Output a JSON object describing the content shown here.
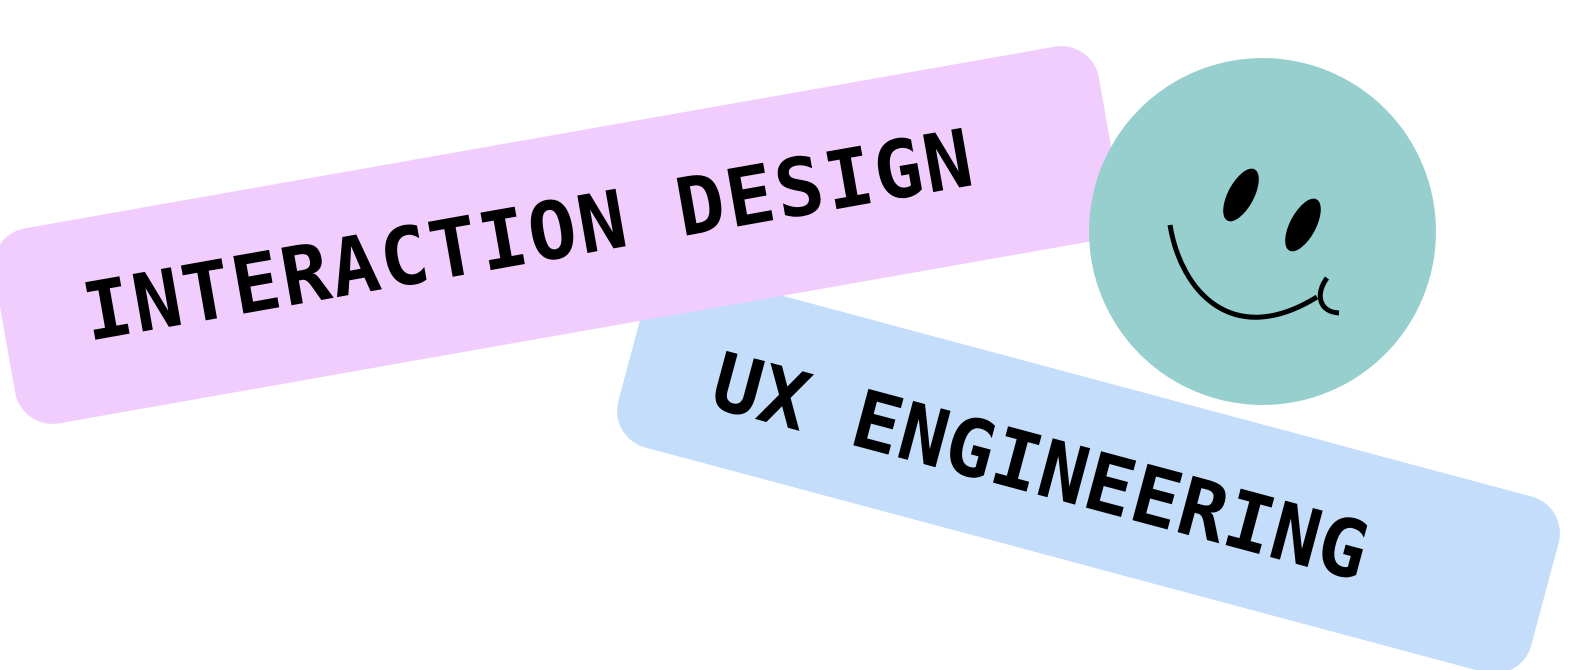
{
  "stickers": {
    "interaction_design": {
      "text": "INTERACTION DESIGN",
      "background": "#f1cdfd"
    },
    "ux_engineering": {
      "text": "UX ENGINEERING",
      "background": "#c3ddfb"
    }
  },
  "smiley": {
    "icon": "smiley-face-icon",
    "face_color": "#97cfcf",
    "feature_color": "#000000"
  }
}
